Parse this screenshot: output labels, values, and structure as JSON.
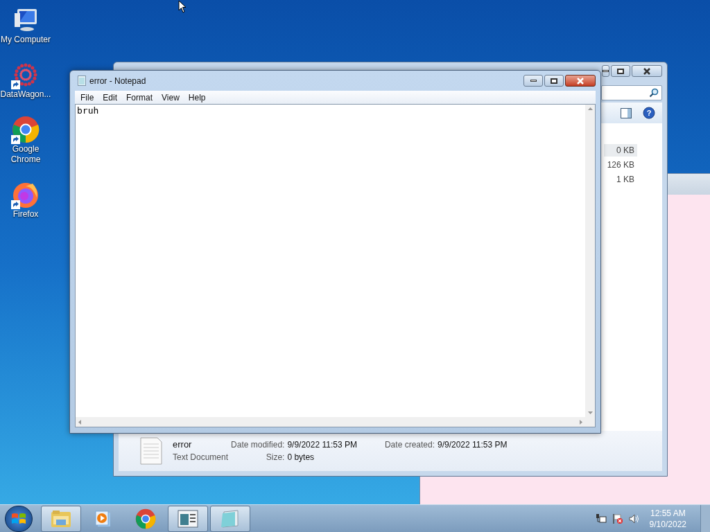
{
  "desktop_icons": [
    {
      "label": "My Computer",
      "kind": "computer",
      "shortcut": false
    },
    {
      "label": "DataWagon...",
      "kind": "dots",
      "shortcut": true
    },
    {
      "label": "Google Chrome",
      "kind": "chrome",
      "shortcut": true
    },
    {
      "label": "Firefox",
      "kind": "firefox",
      "shortcut": true
    }
  ],
  "explorer": {
    "help_label": "?",
    "rows": [
      {
        "size": "0 KB",
        "selected": true
      },
      {
        "size": "126 KB",
        "selected": false
      },
      {
        "size": "1 KB",
        "selected": false
      }
    ],
    "details": {
      "name": "error",
      "type": "Text Document",
      "fields": [
        {
          "label": "Date modified:",
          "value": "9/9/2022 11:53 PM"
        },
        {
          "label": "Date created:",
          "value": "9/9/2022 11:53 PM"
        },
        {
          "label": "Size:",
          "value": "0 bytes"
        }
      ]
    }
  },
  "notepad": {
    "title": "error - Notepad",
    "menu": [
      "File",
      "Edit",
      "Format",
      "View",
      "Help"
    ],
    "content": "bruh"
  },
  "taskbar": {
    "items": [
      {
        "kind": "folder",
        "running": true
      },
      {
        "kind": "media",
        "running": false
      },
      {
        "kind": "chrome",
        "running": false
      },
      {
        "kind": "window",
        "running": true
      },
      {
        "kind": "notepad",
        "running": true
      }
    ],
    "time": "12:55 AM",
    "date": "9/10/2022"
  }
}
